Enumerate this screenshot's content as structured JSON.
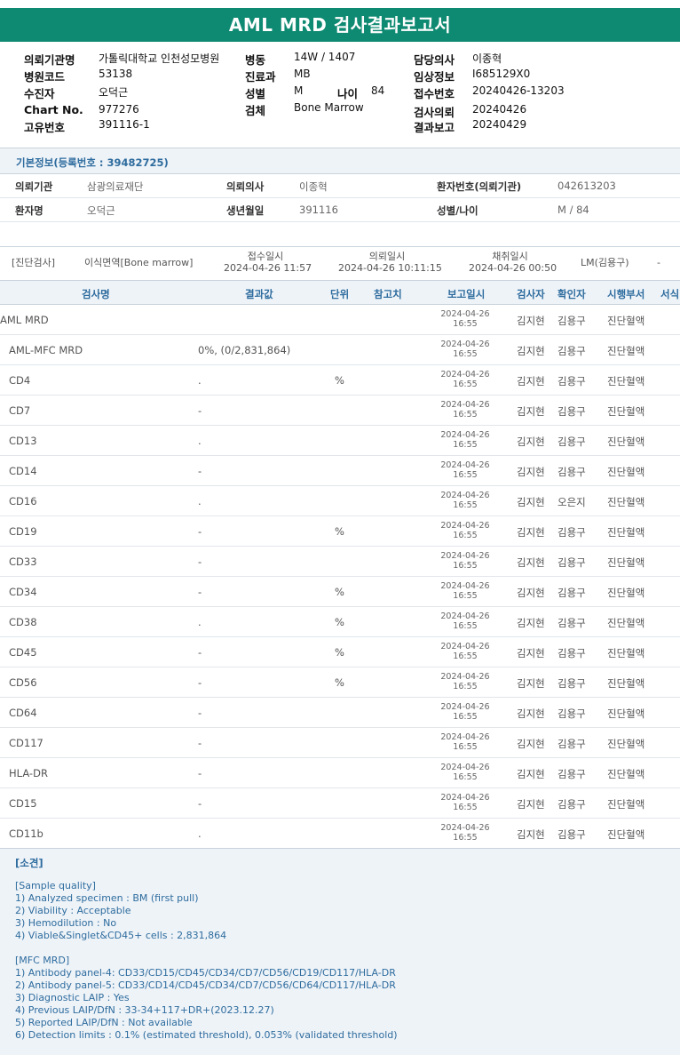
{
  "title": "AML MRD 검사결과보고서",
  "header": {
    "col1": [
      {
        "label": "의뢰기관명",
        "value": "가톨릭대학교 인천성모병원"
      },
      {
        "label": "병원코드",
        "value": "53138"
      },
      {
        "label": "수진자",
        "value": "오덕근"
      },
      {
        "label": "Chart No.",
        "value": "977276"
      },
      {
        "label": "고유번호",
        "value": "391116-1"
      }
    ],
    "col2": [
      {
        "label": "병동",
        "value": "14W / 1407"
      },
      {
        "label": "진료과",
        "value": "MB"
      },
      {
        "label": "성별",
        "value": "M"
      },
      {
        "label": "검체",
        "value": "Bone Marrow"
      }
    ],
    "age_label": "나이",
    "age_value": "84",
    "col3": [
      {
        "label": "담당의사",
        "value": "이종혁"
      },
      {
        "label": "임상정보",
        "value": "I685129X0"
      },
      {
        "label": "접수번호",
        "value": "20240426-13203"
      },
      {
        "label": "검사의뢰",
        "value": "20240426"
      },
      {
        "label": "결과보고",
        "value": "20240429"
      }
    ]
  },
  "basic_info": {
    "title": "기본정보(등록번호 : 39482725)",
    "rows": [
      [
        {
          "label": "의뢰기관",
          "value": "삼광의료재단"
        },
        {
          "label": "의뢰의사",
          "value": "이종혁"
        },
        {
          "label": "환자번호(의뢰기관)",
          "value": "042613203"
        }
      ],
      [
        {
          "label": "환자명",
          "value": "오덕근"
        },
        {
          "label": "생년월일",
          "value": "391116"
        },
        {
          "label": "성별/나이",
          "value": "M / 84"
        }
      ]
    ]
  },
  "diagnosis": {
    "type": "[진단검사]",
    "specimen": "이식면역[Bone marrow]",
    "receipt_label": "접수일시",
    "receipt_value": "2024-04-26 11:57",
    "request_label": "의뢰일시",
    "request_value": "2024-04-26 10:11:15",
    "collect_label": "채취일시",
    "collect_value": "2024-04-26 00:50",
    "reviewer": "LM(김용구)",
    "extra": "-"
  },
  "table": {
    "headers": [
      "검사명",
      "결과값",
      "단위",
      "참고치",
      "보고일시",
      "검사자",
      "확인자",
      "시행부서",
      "서식"
    ],
    "rows": [
      {
        "name": "AML MRD",
        "result": "",
        "unit": "",
        "date": "2024-04-26",
        "time": "16:55",
        "tester": "김지현",
        "checker": "김용구",
        "dept": "진단혈액"
      },
      {
        "name": "AML-MFC MRD",
        "result": "0%, (0/2,831,864)",
        "unit": "",
        "date": "2024-04-26",
        "time": "16:55",
        "tester": "김지현",
        "checker": "김용구",
        "dept": "진단혈액"
      },
      {
        "name": "CD4",
        "result": ".",
        "unit": "%",
        "date": "2024-04-26",
        "time": "16:55",
        "tester": "김지현",
        "checker": "김용구",
        "dept": "진단혈액"
      },
      {
        "name": "CD7",
        "result": "-",
        "unit": "",
        "date": "2024-04-26",
        "time": "16:55",
        "tester": "김지현",
        "checker": "김용구",
        "dept": "진단혈액"
      },
      {
        "name": "CD13",
        "result": ".",
        "unit": "",
        "date": "2024-04-26",
        "time": "16:55",
        "tester": "김지현",
        "checker": "김용구",
        "dept": "진단혈액"
      },
      {
        "name": "CD14",
        "result": "-",
        "unit": "",
        "date": "2024-04-26",
        "time": "16:55",
        "tester": "김지현",
        "checker": "김용구",
        "dept": "진단혈액"
      },
      {
        "name": "CD16",
        "result": ".",
        "unit": "",
        "date": "2024-04-26",
        "time": "16:55",
        "tester": "김지현",
        "checker": "오은지",
        "dept": "진단혈액"
      },
      {
        "name": "CD19",
        "result": "-",
        "unit": "%",
        "date": "2024-04-26",
        "time": "16:55",
        "tester": "김지현",
        "checker": "김용구",
        "dept": "진단혈액"
      },
      {
        "name": "CD33",
        "result": "-",
        "unit": "",
        "date": "2024-04-26",
        "time": "16:55",
        "tester": "김지현",
        "checker": "김용구",
        "dept": "진단혈액"
      },
      {
        "name": "CD34",
        "result": "-",
        "unit": "%",
        "date": "2024-04-26",
        "time": "16:55",
        "tester": "김지현",
        "checker": "김용구",
        "dept": "진단혈액"
      },
      {
        "name": "CD38",
        "result": ".",
        "unit": "%",
        "date": "2024-04-26",
        "time": "16:55",
        "tester": "김지현",
        "checker": "김용구",
        "dept": "진단혈액"
      },
      {
        "name": "CD45",
        "result": "-",
        "unit": "%",
        "date": "2024-04-26",
        "time": "16:55",
        "tester": "김지현",
        "checker": "김용구",
        "dept": "진단혈액"
      },
      {
        "name": "CD56",
        "result": "-",
        "unit": "%",
        "date": "2024-04-26",
        "time": "16:55",
        "tester": "김지현",
        "checker": "김용구",
        "dept": "진단혈액"
      },
      {
        "name": "CD64",
        "result": "-",
        "unit": "",
        "date": "2024-04-26",
        "time": "16:55",
        "tester": "김지현",
        "checker": "김용구",
        "dept": "진단혈액"
      },
      {
        "name": "CD117",
        "result": "-",
        "unit": "",
        "date": "2024-04-26",
        "time": "16:55",
        "tester": "김지현",
        "checker": "김용구",
        "dept": "진단혈액"
      },
      {
        "name": "HLA-DR",
        "result": "-",
        "unit": "",
        "date": "2024-04-26",
        "time": "16:55",
        "tester": "김지현",
        "checker": "김용구",
        "dept": "진단혈액"
      },
      {
        "name": "CD15",
        "result": "-",
        "unit": "",
        "date": "2024-04-26",
        "time": "16:55",
        "tester": "김지현",
        "checker": "김용구",
        "dept": "진단혈액"
      },
      {
        "name": "CD11b",
        "result": ".",
        "unit": "",
        "date": "2024-04-26",
        "time": "16:55",
        "tester": "김지현",
        "checker": "김용구",
        "dept": "진단혈액"
      }
    ]
  },
  "notes": {
    "title": "[소견]",
    "lines": [
      "[Sample quality]",
      "1) Analyzed specimen : BM (first pull)",
      "2) Viability : Acceptable",
      "3) Hemodilution : No",
      "4) Viable&Singlet&CD45+ cells : 2,831,864",
      "",
      "[MFC MRD]",
      "1) Antibody panel-4: CD33/CD15/CD45/CD34/CD7/CD56/CD19/CD117/HLA-DR",
      "2) Antibody panel-5: CD33/CD14/CD45/CD34/CD7/CD56/CD64/CD117/HLA-DR",
      "3) Diagnostic LAIP : Yes",
      "4) Previous LAIP/DfN : 33-34+117+DR+(2023.12.27)",
      "5) Reported LAIP/DfN : Not available",
      "6) Detection limits : 0.1% (estimated threshold), 0.053% (validated threshold)"
    ]
  }
}
